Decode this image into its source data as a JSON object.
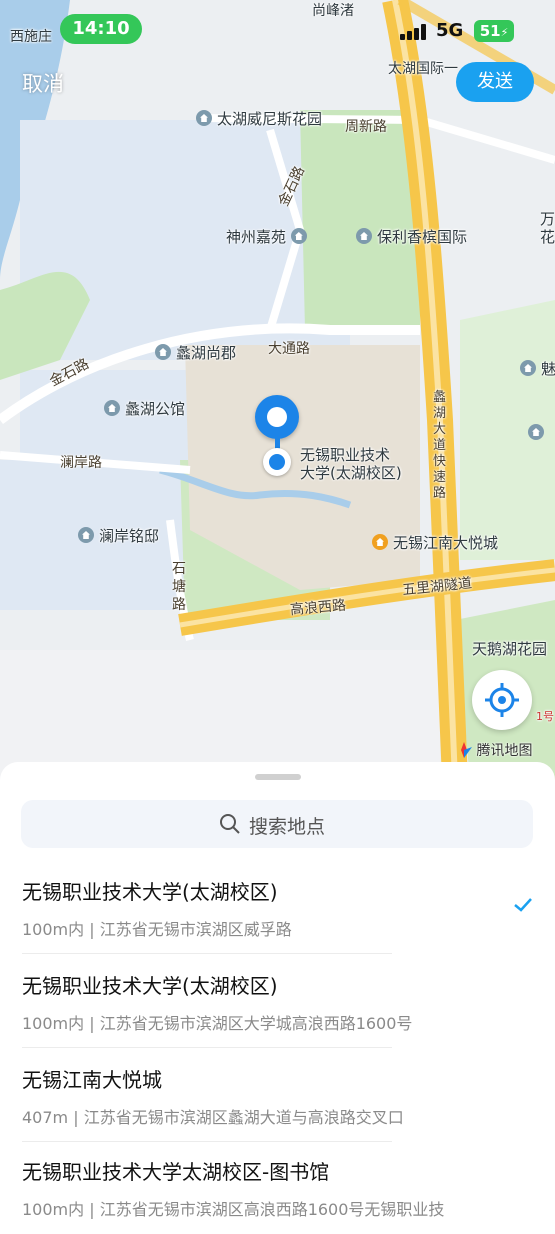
{
  "status_bar": {
    "time": "14:10",
    "network": "5G",
    "battery": "51"
  },
  "header": {
    "cancel_label": "取消",
    "send_label": "发送"
  },
  "map": {
    "labels": {
      "xishizhuang": "西施庄",
      "shangfengzhu": "尚峰渚",
      "taihu_international": "太湖国际一",
      "taihu_venice": "太湖威尼斯花园",
      "zhouxin_road": "周新路",
      "jinshi_road_north": "金石路",
      "shenzhou_jiayuan": "神州嘉苑",
      "poly_xiangbin": "保利香槟国际",
      "wan_hua": "万\n花",
      "lihu_shangjun": "蠡湖尚郡",
      "datong_road": "大通路",
      "jinshi_road_west": "金石路",
      "lihu_gongguan": "蠡湖公馆",
      "lanan_road": "澜岸路",
      "lanan_mingdi": "澜岸铭邸",
      "shitang_road": "石\n塘\n路",
      "university": "无锡职业技术\n大学(太湖校区)",
      "lihu_expressway": "蠡\n湖\n大\n道\n快\n速\n路",
      "jiangnan_mall": "无锡江南大悦城",
      "wulihu_tunnel": "五里湖隧道",
      "gaolang_west": "高浪西路",
      "tiane_garden": "天鹅湖花园",
      "mei": "魅",
      "line1": "1号"
    },
    "attribution": "腾讯地图",
    "icons": [
      "locate-icon",
      "compass-icon"
    ]
  },
  "sheet": {
    "search_placeholder": "搜索地点",
    "results": [
      {
        "title": "无锡职业技术大学(太湖校区)",
        "subtitle": "100m内 | 江苏省无锡市滨湖区威孚路",
        "selected": true
      },
      {
        "title": "无锡职业技术大学(太湖校区)",
        "subtitle": "100m内 | 江苏省无锡市滨湖区大学城高浪西路1600号",
        "selected": false
      },
      {
        "title": "无锡江南大悦城",
        "subtitle": "407m | 江苏省无锡市滨湖区蠡湖大道与高浪路交叉口",
        "selected": false
      },
      {
        "title": "无锡职业技术大学太湖校区-图书馆",
        "subtitle": "100m内 | 江苏省无锡市滨湖区高浪西路1600号无锡职业技",
        "selected": false
      }
    ]
  },
  "colors": {
    "accent": "#1aa1f0",
    "pin": "#1c84e8",
    "status_green": "#34c759",
    "water": "#a9cdea",
    "park": "#c9e6bd"
  }
}
